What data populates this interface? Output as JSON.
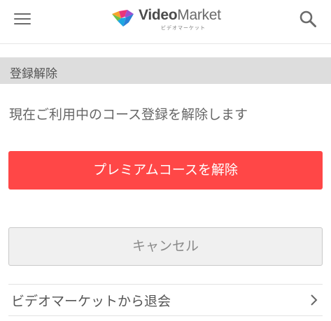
{
  "header": {
    "logo_word_bold": "Video",
    "logo_word_light": "Market",
    "logo_kana": "ビデオマーケット",
    "menu_icon": "hamburger-menu-icon",
    "search_icon": "search-icon"
  },
  "section": {
    "title": "登録解除"
  },
  "main": {
    "message": "現在ご利用中のコース登録を解除します",
    "unsubscribe_label": "プレミアムコースを解除",
    "cancel_label": "キャンセル",
    "withdraw_label": "ビデオマーケットから退会",
    "withdraw_icon": "chevron-right-icon"
  },
  "colors": {
    "accent_red": "#ff4747",
    "section_bg": "#dddddd",
    "cancel_bg": "#f0f0f0",
    "text": "#555555"
  }
}
